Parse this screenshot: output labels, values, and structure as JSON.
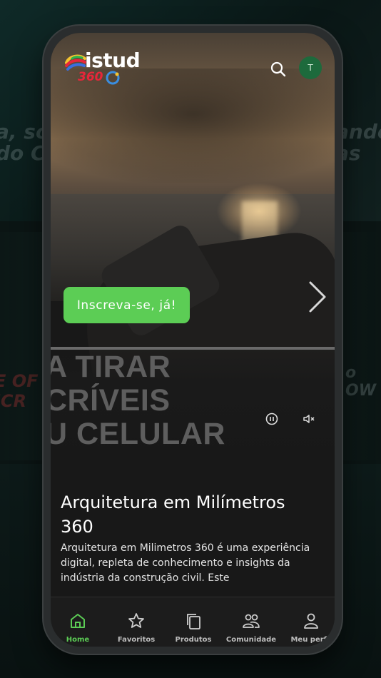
{
  "brand": {
    "logo_word": "istud",
    "logo_number": "360",
    "accent_color": "#5ccd55",
    "logo_red": "#e8263a"
  },
  "header": {
    "search_icon": "search-icon",
    "avatar_initial": "T"
  },
  "hero": {
    "overlay_lines": [
      "A TIRAR",
      "CRÍVEIS",
      "U CELULAR"
    ],
    "cta_label": "Inscreva-se, já!",
    "next_icon": "chevron-right-icon",
    "pause_icon": "pause-icon",
    "mute_icon": "volume-mute-icon"
  },
  "content": {
    "title": "Arquitetura em Milímetros 360",
    "description": "Arquitetura em Milimetros 360 é uma experiência digital, repleta de conhecimento e insights da indústria da construção civil. Este"
  },
  "bottom_nav": {
    "items": [
      {
        "label": "Home",
        "icon": "home-icon",
        "active": true
      },
      {
        "label": "Favoritos",
        "icon": "star-icon",
        "active": false
      },
      {
        "label": "Produtos",
        "icon": "copy-icon",
        "active": false
      },
      {
        "label": "Comunidade",
        "icon": "users-icon",
        "active": false
      },
      {
        "label": "Meu perfil",
        "icon": "user-icon",
        "active": false
      }
    ]
  }
}
